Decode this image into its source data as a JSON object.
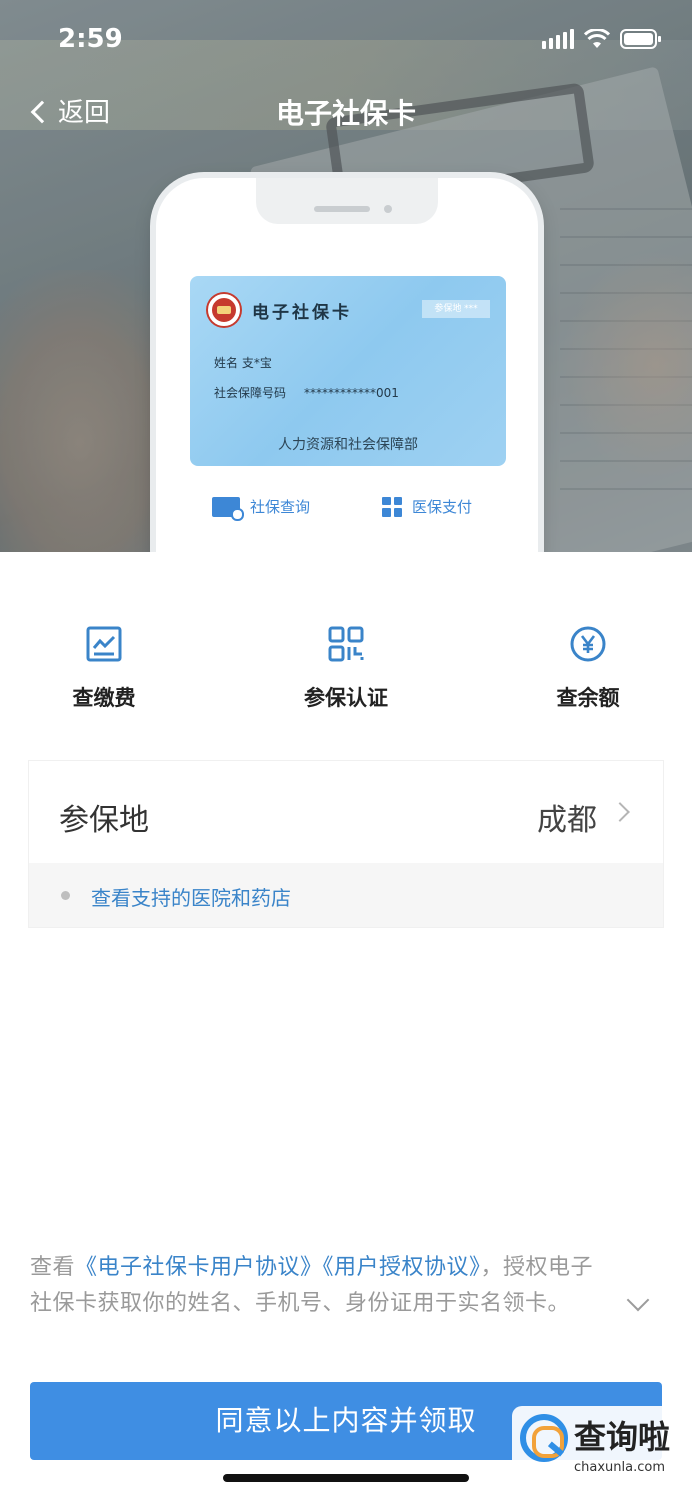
{
  "status_bar": {
    "time": "2:59"
  },
  "nav": {
    "back_label": "返回",
    "title": "电子社保卡"
  },
  "card_preview": {
    "card_title": "电子社保卡",
    "card_tag": "参保地 ***",
    "name_line": "姓名  支*宝",
    "number_label": "社会保障号码",
    "number_value": "************001",
    "issuer": "人力资源和社会保障部",
    "action_query": "社保查询",
    "action_pay": "医保支付"
  },
  "quick_actions": [
    {
      "label": "查缴费",
      "icon": "chart-icon"
    },
    {
      "label": "参保认证",
      "icon": "qr-icon"
    },
    {
      "label": "查余额",
      "icon": "yuan-icon"
    }
  ],
  "location": {
    "label": "参保地",
    "value": "成都",
    "link": "查看支持的医院和药店"
  },
  "agreement": {
    "prefix": "查看",
    "link1": "《电子社保卡用户协议》",
    "link2": "《用户授权协议》",
    "suffix": "，授权电子社保卡获取你的姓名、手机号、身份证用于实名领卡。"
  },
  "claim_button": "同意以上内容并领取",
  "watermark": {
    "text": "查询啦",
    "url": "chaxunla.com"
  },
  "colors": {
    "accent": "#3f8ee3",
    "link": "#3a84c9"
  }
}
